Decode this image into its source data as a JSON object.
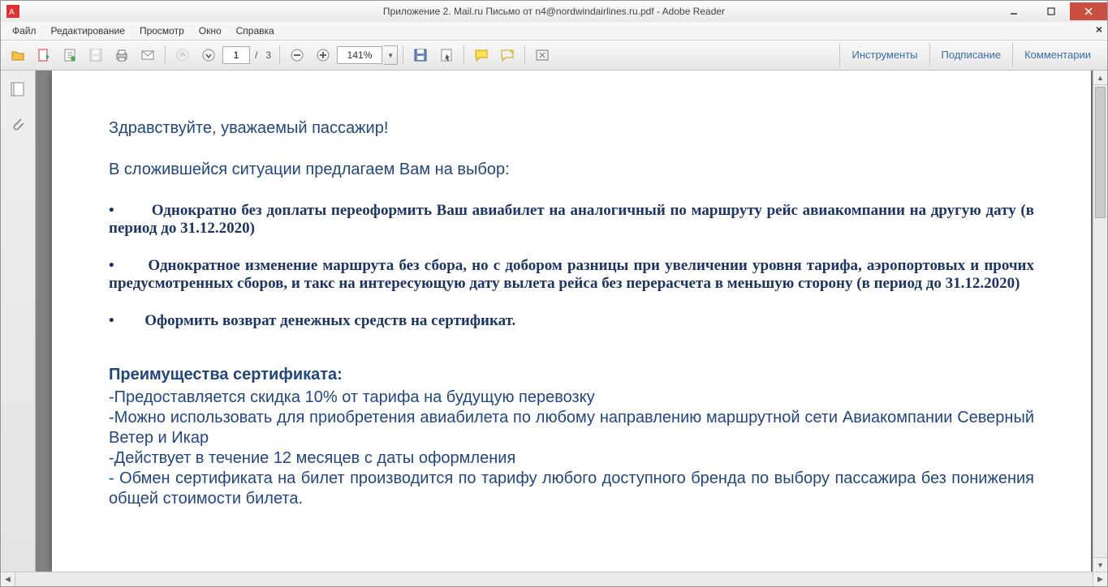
{
  "titlebar": {
    "title": "Приложение 2. Mail.ru Письмо от n4@nordwindairlines.ru.pdf - Adobe Reader"
  },
  "menu": {
    "file": "Файл",
    "edit": "Редактирование",
    "view": "Просмотр",
    "window": "Окно",
    "help": "Справка"
  },
  "toolbar": {
    "page_current": "1",
    "page_sep": "/",
    "page_total": "3",
    "zoom": "141%"
  },
  "panes": {
    "tools": "Инструменты",
    "sign": "Подписание",
    "comments": "Комментарии"
  },
  "doc": {
    "greeting": "Здравствуйте, уважаемый пассажир!",
    "intro": "В сложившейся ситуации предлагаем Вам на выбор:",
    "b1": "Однократно без доплаты переоформить Ваш авиабилет на аналогичный по маршруту рейс авиакомпании на другую дату (в период до 31.12.2020)",
    "b2": "Однократное изменение маршрута без сбора, но с добором разницы при увеличении уровня тарифа, аэропортовых и прочих предусмотренных сборов, и такс на интересующую дату вылета рейса без перерасчета в меньшую сторону (в период до 31.12.2020)",
    "b3": "Оформить возврат денежных средств на сертификат.",
    "adv_head": "Преимущества сертификата:",
    "adv1": "-Предоставляется скидка 10% от тарифа на будущую перевозку",
    "adv2": "-Можно использовать для приобретения авиабилета по любому направлению маршрутной сети Авиакомпании Северный Ветер и Икар",
    "adv3": "-Действует в течение 12 месяцев с даты оформления",
    "adv4": "- Обмен сертификата на билет производится по тарифу любого доступного бренда по выбору пассажира без понижения общей стоимости билета."
  }
}
